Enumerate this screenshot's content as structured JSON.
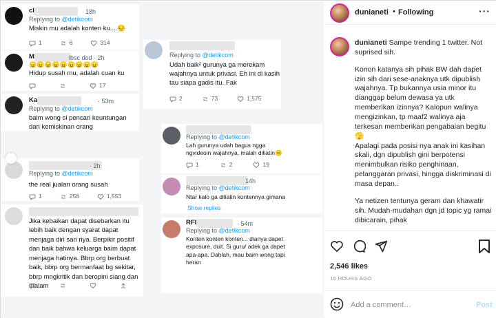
{
  "tweets": {
    "t1": {
      "name": "cl",
      "handle": "18h",
      "reply_prefix": "Replying to",
      "reply_to": "@detikcom",
      "text": "Miskin mu adalah konten ku....😔",
      "reply": "1",
      "rt": "6",
      "like": "314"
    },
    "t2": {
      "name": "M",
      "handle": "lbsc dod · 2h",
      "reply_prefix": "Replying to",
      "reply_to": "@detikcom",
      "text": "Hidup susah mu, adalah cuan ku",
      "emojis": "😠😠😠😠😠😠😠😠😠",
      "reply": "",
      "rt": "",
      "like": "17"
    },
    "t3": {
      "name": "Ka",
      "handle": "· 53m",
      "reply_prefix": "Replying to",
      "reply_to": "@detikcom",
      "text": "baim wong si pencari keuntungan dari kemiskinan orang"
    },
    "t4": {
      "name": "",
      "handle": "· 2h",
      "reply_prefix": "Replying to",
      "reply_to": "@detikcom",
      "text": "the real jualan orang susah",
      "reply": "1",
      "rt": "258",
      "like": "1,553"
    },
    "t5": {
      "name": "",
      "handle": "",
      "text_prefix": "Jika kebaikan dapat",
      "text": "Jika kebaikan dapat disebarkan itu lebih baik dengan syarat dapat menjaga diri sari riya. Berpikir positif dan baik bahwa keluarga baim dapat menjaga hatinya. Bbrp org berbuat baik, bbrp org bermanfaat bg sekitar, bbrp mngkritik dan beropini siang dan malam",
      "reply": "",
      "rt": "",
      "like": ""
    },
    "t6": {
      "name": "",
      "handle": "",
      "reply_prefix": "Replying to",
      "reply_to": "@detikcom",
      "text": "Udah baik² gurunya ga merekam wajahnya untuk privasi. Eh ini di kasih tau siapa gadis itu. Fak",
      "reply": "2",
      "rt": "73",
      "like": "1,575"
    },
    "t7": {
      "name": "",
      "handle": "",
      "reply_prefix": "Replying to",
      "reply_to": "@detikcom",
      "text": "Lah gurunya udah bagus ngga ngvideoin wajahnya, malah diliatin😑",
      "reply": "1",
      "rt": "2",
      "like": "19"
    },
    "t8": {
      "name": "",
      "handle": "14h",
      "reply_prefix": "Replying to",
      "reply_to": "@detikcom",
      "text": "Ntar kalo ga diliatin kontennya gimana",
      "show_replies": "Show replies"
    },
    "t9": {
      "name": "RFI",
      "handle": "· 54m",
      "reply_prefix": "Replying to",
      "reply_to": "@detikcom",
      "text": "Konten konten konten... dianya dapet exposure, duit. Si guru/ adek ga dapet apa-apa. Dahlah, mau baim wong tapi heran"
    }
  },
  "sidebar": {
    "username": "dunianeti",
    "separator": "•",
    "following": "Following",
    "more": "···",
    "caption": {
      "username": "dunianeti",
      "p1": "Sampe trending 1 twitter. Not suprised sih.",
      "p2": "Konon katanya sih pihak BW dah dapet izin sih dari sese-anaknya utk dipublish wajahnya. Tp bukannya usia minor itu dianggap belum dewasa ya utk memberikan izinnya? Kalopun walinya mengizinkan, tp maaf2 walinya aja terkesan memberikan pengabaian begitu 🫣",
      "p3": "Apalagi pada posisi nya anak ini kasihan skali, dgn dipublish gini berpotensi menimbulkan risiko penghinaan, pelanggaran privasi, hingga diskriminasi di masa depan..",
      "p4": "Ya netizen tentunya geram dan khawatir sih. Mudah-mudahan dgn jd topic yg ramai dibicarain, pihak"
    },
    "likes": "2,546 likes",
    "time_ago": "16 HOURS AGO",
    "comment_placeholder": "Add a comment…",
    "post_label": "Post"
  },
  "colors": {
    "link": "#1d9bf0",
    "accent_post": "#b2dffc"
  }
}
